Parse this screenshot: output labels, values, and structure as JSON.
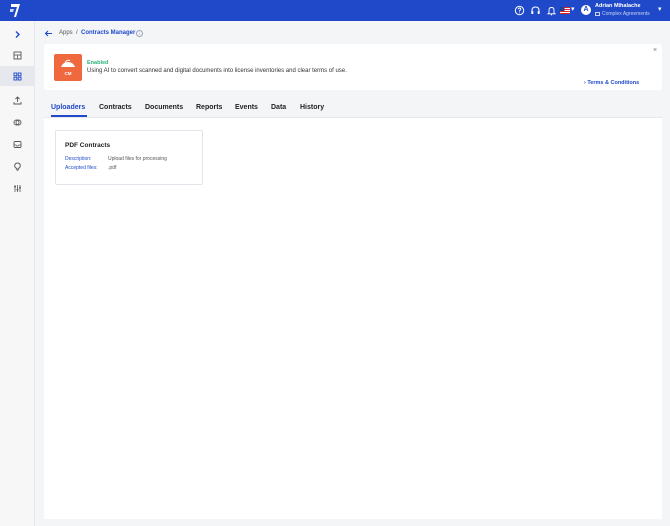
{
  "header": {
    "user_name": "Adrian Mihalache",
    "user_org": "Complex Agreements",
    "avatar_initial": "A"
  },
  "breadcrumb": {
    "apps": "Apps",
    "separator": "/",
    "current": "Contracts Manager"
  },
  "banner": {
    "logo_text": "CM",
    "status": "Enabled",
    "description": "Using AI to convert scanned and digital documents into license inventories and clear terms of use.",
    "terms_link": "› Terms & Conditions",
    "close": "×"
  },
  "tabs": [
    {
      "label": "Uploaders"
    },
    {
      "label": "Contracts"
    },
    {
      "label": "Documents"
    },
    {
      "label": "Reports"
    },
    {
      "label": "Events"
    },
    {
      "label": "Data"
    },
    {
      "label": "History"
    }
  ],
  "uploader_card": {
    "title": "PDF Contracts",
    "description_label": "Description:",
    "description_value": "Upload files for processing",
    "accepted_label": "Accepted files:",
    "accepted_value": ".pdf"
  },
  "colors": {
    "brand": "#1f49c9",
    "app_logo": "#f0683e",
    "enabled": "#2eb07a"
  },
  "icons": {
    "sidebar": [
      "chevron-right-icon",
      "dashboard-icon",
      "apps-grid-icon",
      "upload-icon",
      "handshake-icon",
      "inbox-icon",
      "lightbulb-icon",
      "sliders-icon"
    ],
    "topbar": [
      "help-icon",
      "headset-icon",
      "bell-icon",
      "us-flag-icon",
      "chevron-down-icon"
    ]
  }
}
